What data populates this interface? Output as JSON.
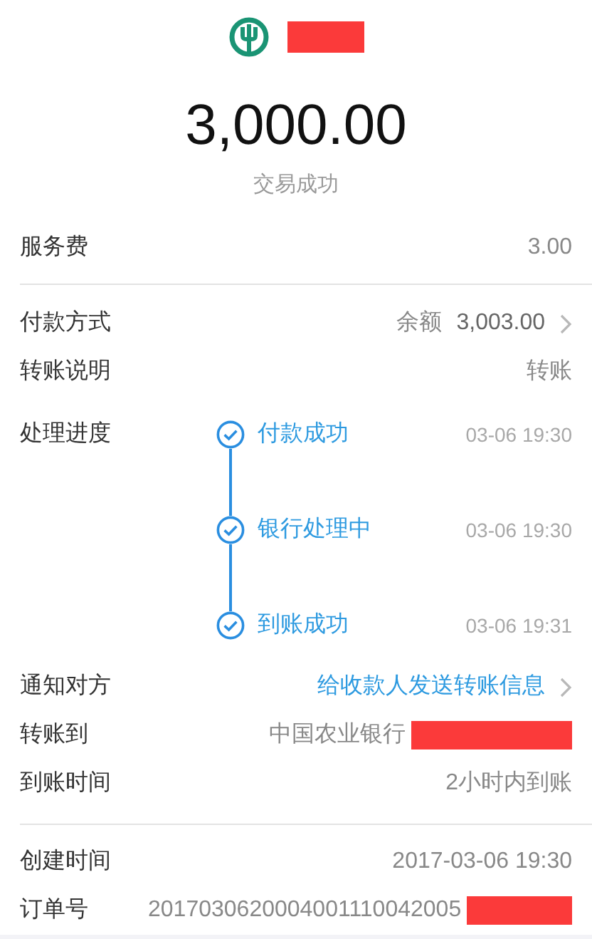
{
  "header": {
    "amount": "3,000.00",
    "status": "交易成功"
  },
  "sections": [
    {
      "rows": [
        {
          "kind": "value",
          "label": "服务费",
          "value": "3.00"
        }
      ]
    },
    {
      "rows": [
        {
          "kind": "balance",
          "label": "付款方式",
          "prefix": "余额",
          "value": "3,003.00"
        },
        {
          "kind": "value",
          "label": "转账说明",
          "value": "转账"
        },
        {
          "kind": "progress",
          "label": "处理进度",
          "steps": [
            {
              "label": "付款成功",
              "time": "03-06 19:30",
              "done": true
            },
            {
              "label": "银行处理中",
              "time": "03-06 19:30",
              "done": true
            },
            {
              "label": "到账成功",
              "time": "03-06 19:31",
              "done": true
            }
          ]
        },
        {
          "kind": "link",
          "label": "通知对方",
          "value": "给收款人发送转账信息"
        },
        {
          "kind": "redacted",
          "label": "转账到",
          "value": "中国农业银行"
        },
        {
          "kind": "value",
          "label": "到账时间",
          "value": "2小时内到账"
        }
      ]
    },
    {
      "rows": [
        {
          "kind": "value",
          "label": "创建时间",
          "value": "2017-03-06 19:30"
        },
        {
          "kind": "redacted",
          "label": "订单号",
          "value": "2017030620004001110042005"
        }
      ]
    }
  ]
}
